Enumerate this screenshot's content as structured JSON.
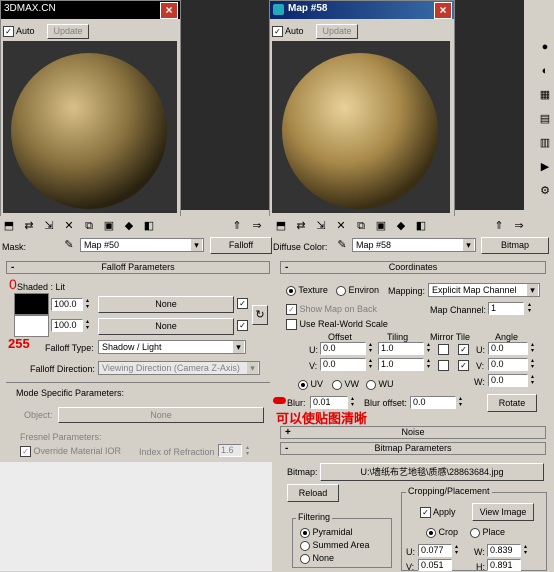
{
  "watermark": "3DMAX.CN",
  "left_window": {
    "auto_label": "Auto",
    "update_label": "Update",
    "close_glyph": "×"
  },
  "right_window": {
    "title": "Map #58",
    "auto_label": "Auto",
    "update_label": "Update",
    "close_glyph": "×"
  },
  "left_panel": {
    "mask_label": "Mask:",
    "map_name": "Map #50",
    "map_type": "Falloff",
    "rollout_title": "Falloff Parameters",
    "shaded_label": "Shaded : Lit",
    "annotation_zero": "0",
    "annotation_255": "255",
    "row1_value": "100.0",
    "row1_map": "None",
    "row2_value": "100.0",
    "row2_map": "None",
    "falloff_type_label": "Falloff Type:",
    "falloff_type_value": "Shadow / Light",
    "falloff_dir_label": "Falloff Direction:",
    "falloff_dir_value": "Viewing Direction (Camera Z-Axis)",
    "mode_specific_title": "Mode Specific Parameters:",
    "object_label": "Object:",
    "object_value": "None",
    "fresnel_label": "Fresnel Parameters:",
    "override_label": "Override Material IOR",
    "ior_label": "Index of Refraction",
    "ior_value": "1.6"
  },
  "right_panel": {
    "diffuse_label": "Diffuse Color:",
    "map_name": "Map #58",
    "map_type": "Bitmap",
    "coordinates_title": "Coordinates",
    "texture_label": "Texture",
    "environ_label": "Environ",
    "mapping_label": "Mapping:",
    "mapping_value": "Explicit Map Channel",
    "show_map_label": "Show Map on Back",
    "map_channel_label": "Map Channel:",
    "map_channel_value": "1",
    "real_world_label": "Use Real-World Scale",
    "offset_label": "Offset",
    "tiling_label": "Tiling",
    "mirror_tile_label": "Mirror Tile",
    "angle_label": "Angle",
    "u_label": "U:",
    "v_label": "V:",
    "w_label": "W:",
    "u_offset": "0.0",
    "v_offset": "0.0",
    "u_tiling": "1.0",
    "v_tiling": "1.0",
    "u_angle": "0.0",
    "v_angle": "0.0",
    "w_angle": "0.0",
    "uv_label": "UV",
    "vw_label": "VW",
    "wu_label": "WU",
    "blur_label": "Blur:",
    "blur_value": "0.01",
    "blur_offset_label": "Blur offset:",
    "blur_offset_value": "0.0",
    "rotate_label": "Rotate",
    "annotation_chinese": "可以使贴图清晰",
    "noise_title": "Noise",
    "bitmap_params_title": "Bitmap Parameters",
    "bitmap_label": "Bitmap:",
    "bitmap_path": "U:\\墙纸布艺地毯\\质感\\28863684.jpg",
    "reload_label": "Reload",
    "cropping_title": "Cropping/Placement",
    "apply_label": "Apply",
    "view_image_label": "View Image",
    "crop_label": "Crop",
    "place_label": "Place",
    "filtering_title": "Filtering",
    "pyramidal_label": "Pyramidal",
    "summed_area_label": "Summed Area",
    "none_label": "None",
    "crop_u_value": "0.077",
    "crop_v_value": "0.051",
    "crop_w_value": "0.839",
    "crop_h_value": "0.891"
  },
  "colors": {
    "annotation_red": "#e00000",
    "title_blue": "#0a246a",
    "panel_gray": "#d4d0c8"
  }
}
